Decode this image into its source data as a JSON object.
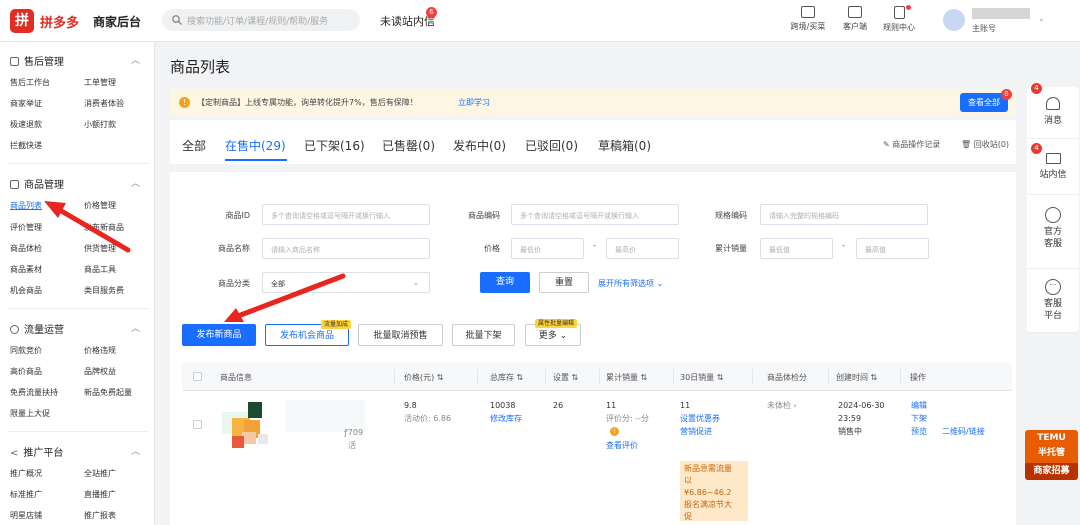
{
  "app": {
    "logo_glyph": "拼",
    "brand": "拼多多",
    "title": "商家后台"
  },
  "search": {
    "placeholder": "搜索功能/订单/课程/规则/帮助/服务"
  },
  "header": {
    "unread_label": "未读站内信",
    "unread_badge": "6",
    "icons": [
      {
        "label": "跨境/买菜",
        "icon": "box-icon"
      },
      {
        "label": "客户端",
        "icon": "monitor-icon"
      },
      {
        "label": "规则中心",
        "icon": "document-icon"
      }
    ],
    "user_role": "主账号"
  },
  "sidebar": {
    "sections": [
      {
        "title": "售后管理",
        "icon": "service-icon",
        "items": [
          "售后工作台",
          "工单管理",
          "商家举证",
          "消费者体验",
          "极速退款",
          "小额打款",
          "拦截快递"
        ]
      },
      {
        "title": "商品管理",
        "icon": "goods-icon",
        "items": [
          "商品列表",
          "价格管理",
          "评价管理",
          "发布新商品",
          "商品体检",
          "供货管理",
          "商品素材",
          "商品工具",
          "机会商品",
          "类目服务费"
        ]
      },
      {
        "title": "流量运营",
        "icon": "traffic-icon",
        "items": [
          "同款竞价",
          "价格违规",
          "高价商品",
          "品牌权益",
          "免费流量扶持",
          "新品免费起量",
          "限量上大促"
        ]
      },
      {
        "title": "推广平台",
        "icon": "share-icon",
        "items": [
          "推广概况",
          "全站推广",
          "标准推广",
          "直播推广",
          "明星店铺",
          "推广报表"
        ]
      }
    ]
  },
  "page": {
    "title": "商品列表"
  },
  "notice": {
    "text": "【定制商品】上线专属功能，询单转化提升7%，售后有保障！",
    "link": "立即学习",
    "button": "查看全部",
    "badge": "8"
  },
  "tabs": [
    {
      "label": "全部"
    },
    {
      "label": "在售中(29)"
    },
    {
      "label": "已下架(16)"
    },
    {
      "label": "已售罄(0)"
    },
    {
      "label": "发布中(0)"
    },
    {
      "label": "已驳回(0)"
    },
    {
      "label": "草稿箱(0)"
    }
  ],
  "tab_actions": {
    "log": "商品操作记录",
    "recycle": "回收站(0)"
  },
  "filters": {
    "product_id": {
      "label": "商品ID",
      "placeholder": "多个查询请空格或逗号隔开或换行输入"
    },
    "product_code": {
      "label": "商品编码",
      "placeholder": "多个查询请空格或逗号隔开或换行输入"
    },
    "spec_code": {
      "label": "规格编码",
      "placeholder": "请输入完整的规格编码"
    },
    "product_name": {
      "label": "商品名称",
      "placeholder": "请输入商品名称"
    },
    "price": {
      "label": "价格",
      "min": "最低价",
      "max": "最高价"
    },
    "sales": {
      "label": "累计销量",
      "min": "最低值",
      "max": "最高值"
    },
    "category": {
      "label": "商品分类",
      "value": "全部"
    },
    "query": "查询",
    "reset": "重置",
    "expand": "展开所有筛选项"
  },
  "actions": {
    "publish_new": "发布新商品",
    "publish_opportunity": "发布机会商品",
    "opp_tag": "流量加成",
    "batch_cancel_presale": "批量取消预售",
    "batch_offshelf": "批量下架",
    "more": "更多",
    "more_tag": "属性批量编辑"
  },
  "table": {
    "headers": [
      "商品信息",
      "价格(元)",
      "总库存",
      "设置",
      "累计销量",
      "30日销量",
      "商品体检分",
      "创建时间",
      "操作"
    ],
    "row": {
      "id_frag": "ꝭ709",
      "id_frag2": "活",
      "price": "9.8",
      "activity_price": "活动价: 6.86",
      "stock": "10038",
      "stock_action": "修改库存",
      "setting": "26",
      "sales": "11",
      "review_score": "评价分: --分",
      "review_link": "查看评价",
      "sales30": "11",
      "coupon": "设置优惠券",
      "promo": "营销促进",
      "promo_box": [
        "新品急需流量",
        "以",
        "¥6.86~46.2",
        "报名满凉节大",
        "促"
      ],
      "health": "未体检 ›",
      "created": "2024-06-30 23:59",
      "status": "销售中",
      "ops": [
        "编辑",
        "下架",
        "预览"
      ],
      "qr": "二维码/链接"
    }
  },
  "right_panel": [
    {
      "label": "消息",
      "badge": "4"
    },
    {
      "label": "站内信",
      "badge": "4"
    },
    {
      "label": "官方客服"
    },
    {
      "label": "客服平台"
    }
  ],
  "temu": {
    "line1": "TEMU",
    "line2": "半托管",
    "line3": "商家招募"
  },
  "colors": {
    "brand": "#e02e24",
    "accent": "#1a6eff",
    "annotation": "#e8251f"
  }
}
